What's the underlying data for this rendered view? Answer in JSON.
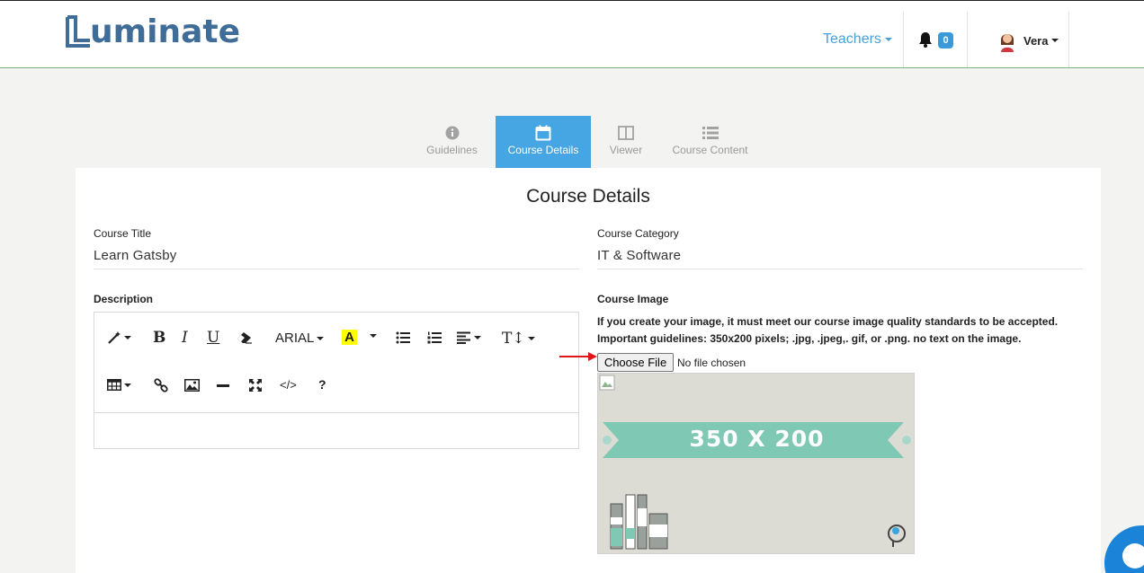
{
  "brand": {
    "logo_text": "uminate",
    "logo_color": "#3f6d98"
  },
  "nav": {
    "teachers_label": "Teachers",
    "notifications_count": "0",
    "user_name": "Vera"
  },
  "steps": [
    {
      "label": "Guidelines",
      "icon": "info-circle-icon",
      "active": false
    },
    {
      "label": "Course Details",
      "icon": "calendar-icon",
      "active": true
    },
    {
      "label": "Viewer",
      "icon": "columns-icon",
      "active": false
    },
    {
      "label": "Course Content",
      "icon": "list-icon",
      "active": false
    }
  ],
  "form": {
    "title": "Course Details",
    "course_title_label": "Course Title",
    "course_title_value": "Learn Gatsby",
    "course_category_label": "Course Category",
    "course_category_value": "IT & Software",
    "description_label": "Description",
    "course_image_label": "Course Image",
    "image_guidelines": "If you create your image, it must meet our course image quality standards to be accepted. Important guidelines: 350x200 pixels; .jpg, .jpeg,. gif, or .png. no text on the image.",
    "choose_file_label": "Choose File",
    "file_status": "No file chosen",
    "placeholder_image_text": "350 X 200"
  },
  "editor": {
    "font_name": "ARIAL"
  },
  "colors": {
    "accent": "#46a6e4",
    "badge": "#3a9ad9",
    "banner": "#7ec8b4",
    "arrow": "#e01515",
    "chat": "#1b84d8"
  }
}
